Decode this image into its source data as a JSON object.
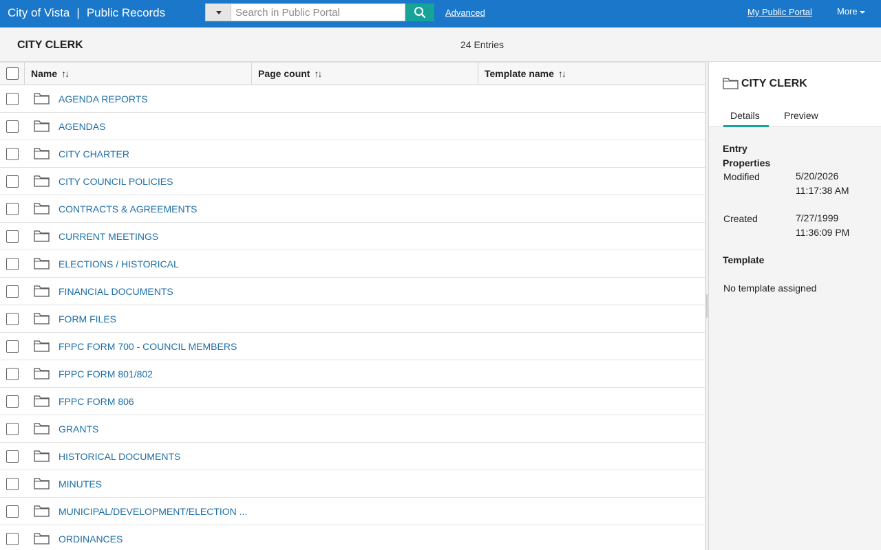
{
  "header": {
    "brand": "City of Vista",
    "separator": "|",
    "section": "Public Records",
    "search_placeholder": "Search in Public Portal",
    "advanced_label": "Advanced",
    "my_portal_label": "My Public Portal",
    "more_label": "More"
  },
  "folder": {
    "title": "CITY CLERK",
    "entries": "24 Entries"
  },
  "table": {
    "columns": [
      {
        "label": "Name"
      },
      {
        "label": "Page count"
      },
      {
        "label": "Template name"
      }
    ],
    "rows": [
      {
        "name": "AGENDA REPORTS"
      },
      {
        "name": "AGENDAS"
      },
      {
        "name": "CITY CHARTER"
      },
      {
        "name": "CITY COUNCIL POLICIES"
      },
      {
        "name": "CONTRACTS & AGREEMENTS"
      },
      {
        "name": "CURRENT MEETINGS"
      },
      {
        "name": "ELECTIONS / HISTORICAL"
      },
      {
        "name": "FINANCIAL DOCUMENTS"
      },
      {
        "name": "FORM FILES"
      },
      {
        "name": "FPPC FORM 700 - COUNCIL MEMBERS"
      },
      {
        "name": "FPPC FORM 801/802"
      },
      {
        "name": "FPPC FORM 806"
      },
      {
        "name": "GRANTS"
      },
      {
        "name": "HISTORICAL DOCUMENTS"
      },
      {
        "name": "MINUTES"
      },
      {
        "name": "MUNICIPAL/DEVELOPMENT/ELECTION ..."
      },
      {
        "name": "ORDINANCES"
      }
    ]
  },
  "panel": {
    "title": "CITY CLERK",
    "tabs": [
      "Details",
      "Preview"
    ],
    "entry_properties_line1": "Entry",
    "entry_properties_line2": "Properties",
    "modified_label": "Modified",
    "modified_date": "5/20/2026",
    "modified_time": "11:17:38 AM",
    "created_label": "Created",
    "created_date": "7/27/1999",
    "created_time": "11:36:09 PM",
    "template_heading": "Template",
    "template_value": "No template assigned"
  },
  "colors": {
    "topbar": "#1a77c9",
    "accent": "#17a398",
    "link": "#1c6ea7"
  }
}
